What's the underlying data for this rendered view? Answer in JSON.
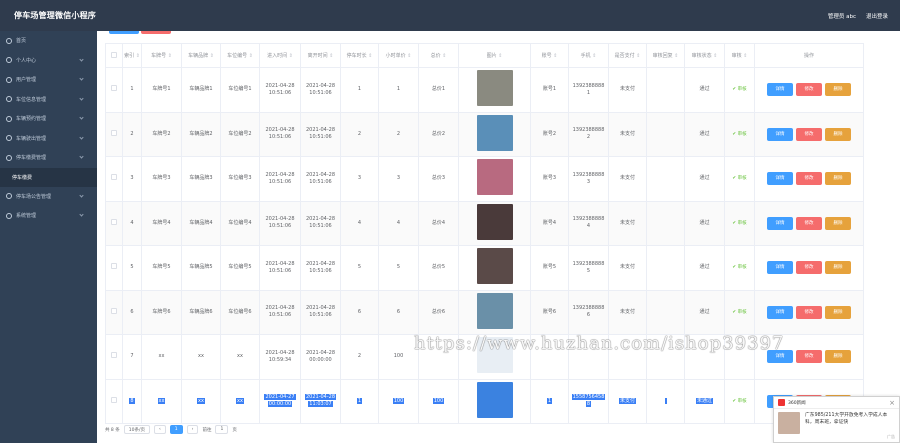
{
  "header": {
    "title": "停车场管理微信小程序",
    "admin": "管理员 abc",
    "logout": "退出登录"
  },
  "sidebar": {
    "items": [
      "首页",
      "个人中心",
      "用户管理",
      "车位信息管理",
      "车辆预约管理",
      "车辆驶出管理",
      "停车缴费管理",
      "停车场公告管理",
      "系统管理"
    ],
    "sub_item": "停车缴费"
  },
  "table": {
    "headers": [
      "",
      "索引",
      "车牌号",
      "车辆品牌",
      "车位编号",
      "进入时间",
      "离开时间",
      "停车时长",
      "小时单价",
      "总价",
      "图片",
      "账号",
      "手机",
      "是否支付",
      "审核回复",
      "审核状态",
      "审核",
      "操作"
    ],
    "rows": [
      {
        "idx": "1",
        "plate": "车牌号1",
        "brand": "车辆品牌1",
        "slot": "车位编号1",
        "enter": [
          "2021-04-28",
          "10:51:06"
        ],
        "leave": [
          "2021-04-28",
          "10:51:06"
        ],
        "hours": "1",
        "price": "1",
        "total": "总价1",
        "account": "账号1",
        "phone": [
          "1392388888",
          "1"
        ],
        "paid": "未支付",
        "reply": "",
        "status": "通过",
        "img": "#8a8a80"
      },
      {
        "idx": "2",
        "plate": "车牌号2",
        "brand": "车辆品牌2",
        "slot": "车位编号2",
        "enter": [
          "2021-04-28",
          "10:51:06"
        ],
        "leave": [
          "2021-04-28",
          "10:51:06"
        ],
        "hours": "2",
        "price": "2",
        "total": "总价2",
        "account": "账号2",
        "phone": [
          "1392388888",
          "2"
        ],
        "paid": "未支付",
        "reply": "",
        "status": "通过",
        "img": "#5a8fb8"
      },
      {
        "idx": "3",
        "plate": "车牌号3",
        "brand": "车辆品牌3",
        "slot": "车位编号3",
        "enter": [
          "2021-04-28",
          "10:51:06"
        ],
        "leave": [
          "2021-04-28",
          "10:51:06"
        ],
        "hours": "3",
        "price": "3",
        "total": "总价3",
        "account": "账号3",
        "phone": [
          "1392388888",
          "3"
        ],
        "paid": "未支付",
        "reply": "",
        "status": "通过",
        "img": "#b86a80"
      },
      {
        "idx": "4",
        "plate": "车牌号4",
        "brand": "车辆品牌4",
        "slot": "车位编号4",
        "enter": [
          "2021-04-28",
          "10:51:06"
        ],
        "leave": [
          "2021-04-28",
          "10:51:06"
        ],
        "hours": "4",
        "price": "4",
        "total": "总价4",
        "account": "账号4",
        "phone": [
          "1392388888",
          "4"
        ],
        "paid": "未支付",
        "reply": "",
        "status": "通过",
        "img": "#4a3a3a"
      },
      {
        "idx": "5",
        "plate": "车牌号5",
        "brand": "车辆品牌5",
        "slot": "车位编号5",
        "enter": [
          "2021-04-28",
          "10:51:06"
        ],
        "leave": [
          "2021-04-28",
          "10:51:06"
        ],
        "hours": "5",
        "price": "5",
        "total": "总价5",
        "account": "账号5",
        "phone": [
          "1392388888",
          "5"
        ],
        "paid": "未支付",
        "reply": "",
        "status": "通过",
        "img": "#5a4a48"
      },
      {
        "idx": "6",
        "plate": "车牌号6",
        "brand": "车辆品牌6",
        "slot": "车位编号6",
        "enter": [
          "2021-04-28",
          "10:51:06"
        ],
        "leave": [
          "2021-04-28",
          "10:51:06"
        ],
        "hours": "6",
        "price": "6",
        "total": "总价6",
        "account": "账号6",
        "phone": [
          "1392388888",
          "6"
        ],
        "paid": "未支付",
        "reply": "",
        "status": "通过",
        "img": "#6a90a8"
      },
      {
        "idx": "7",
        "plate": "xx",
        "brand": "xx",
        "slot": "xx",
        "enter": [
          "2021-04-28",
          "10:59:34"
        ],
        "leave": [
          "2021-04-28",
          "00:00:00"
        ],
        "hours": "2",
        "price": "100",
        "total": "",
        "account": "",
        "phone": [
          "",
          ""
        ],
        "paid": "",
        "reply": "",
        "status": "",
        "img": "#e8eef4"
      },
      {
        "idx": "8",
        "plate": "xx",
        "brand": "xx",
        "slot": "xx",
        "enter": [
          "2021-04-27",
          "00:00:00"
        ],
        "leave": [
          "2021-04-28",
          "11:03:07"
        ],
        "hours": "1",
        "price": "100",
        "total": "100",
        "account": "1",
        "phone": [
          "1558756458",
          "8"
        ],
        "paid": "未支付",
        "reply": "",
        "status": "未通过",
        "img": "#3b82e0"
      }
    ],
    "ok_label": "✔ 审核",
    "btn_detail": "详情",
    "btn_edit": "修改",
    "btn_delete": "删除"
  },
  "pager": {
    "total": "共 8 条",
    "size": "10条/页",
    "page": "1",
    "goto": "前往",
    "goto_val": "1",
    "unit": "页"
  },
  "watermark": "https://www.huzhan.com/ishop39397",
  "popup": {
    "source": "360新闻",
    "text": "广东985/211大学开放免考入学成人本科，周末班，拿证快",
    "ad": "广告"
  },
  "colors": {
    "topbar": "#2f3b4d",
    "sidebar": "#304156",
    "primary": "#409eff",
    "danger": "#f56c6c",
    "warning": "#e6a23c"
  }
}
